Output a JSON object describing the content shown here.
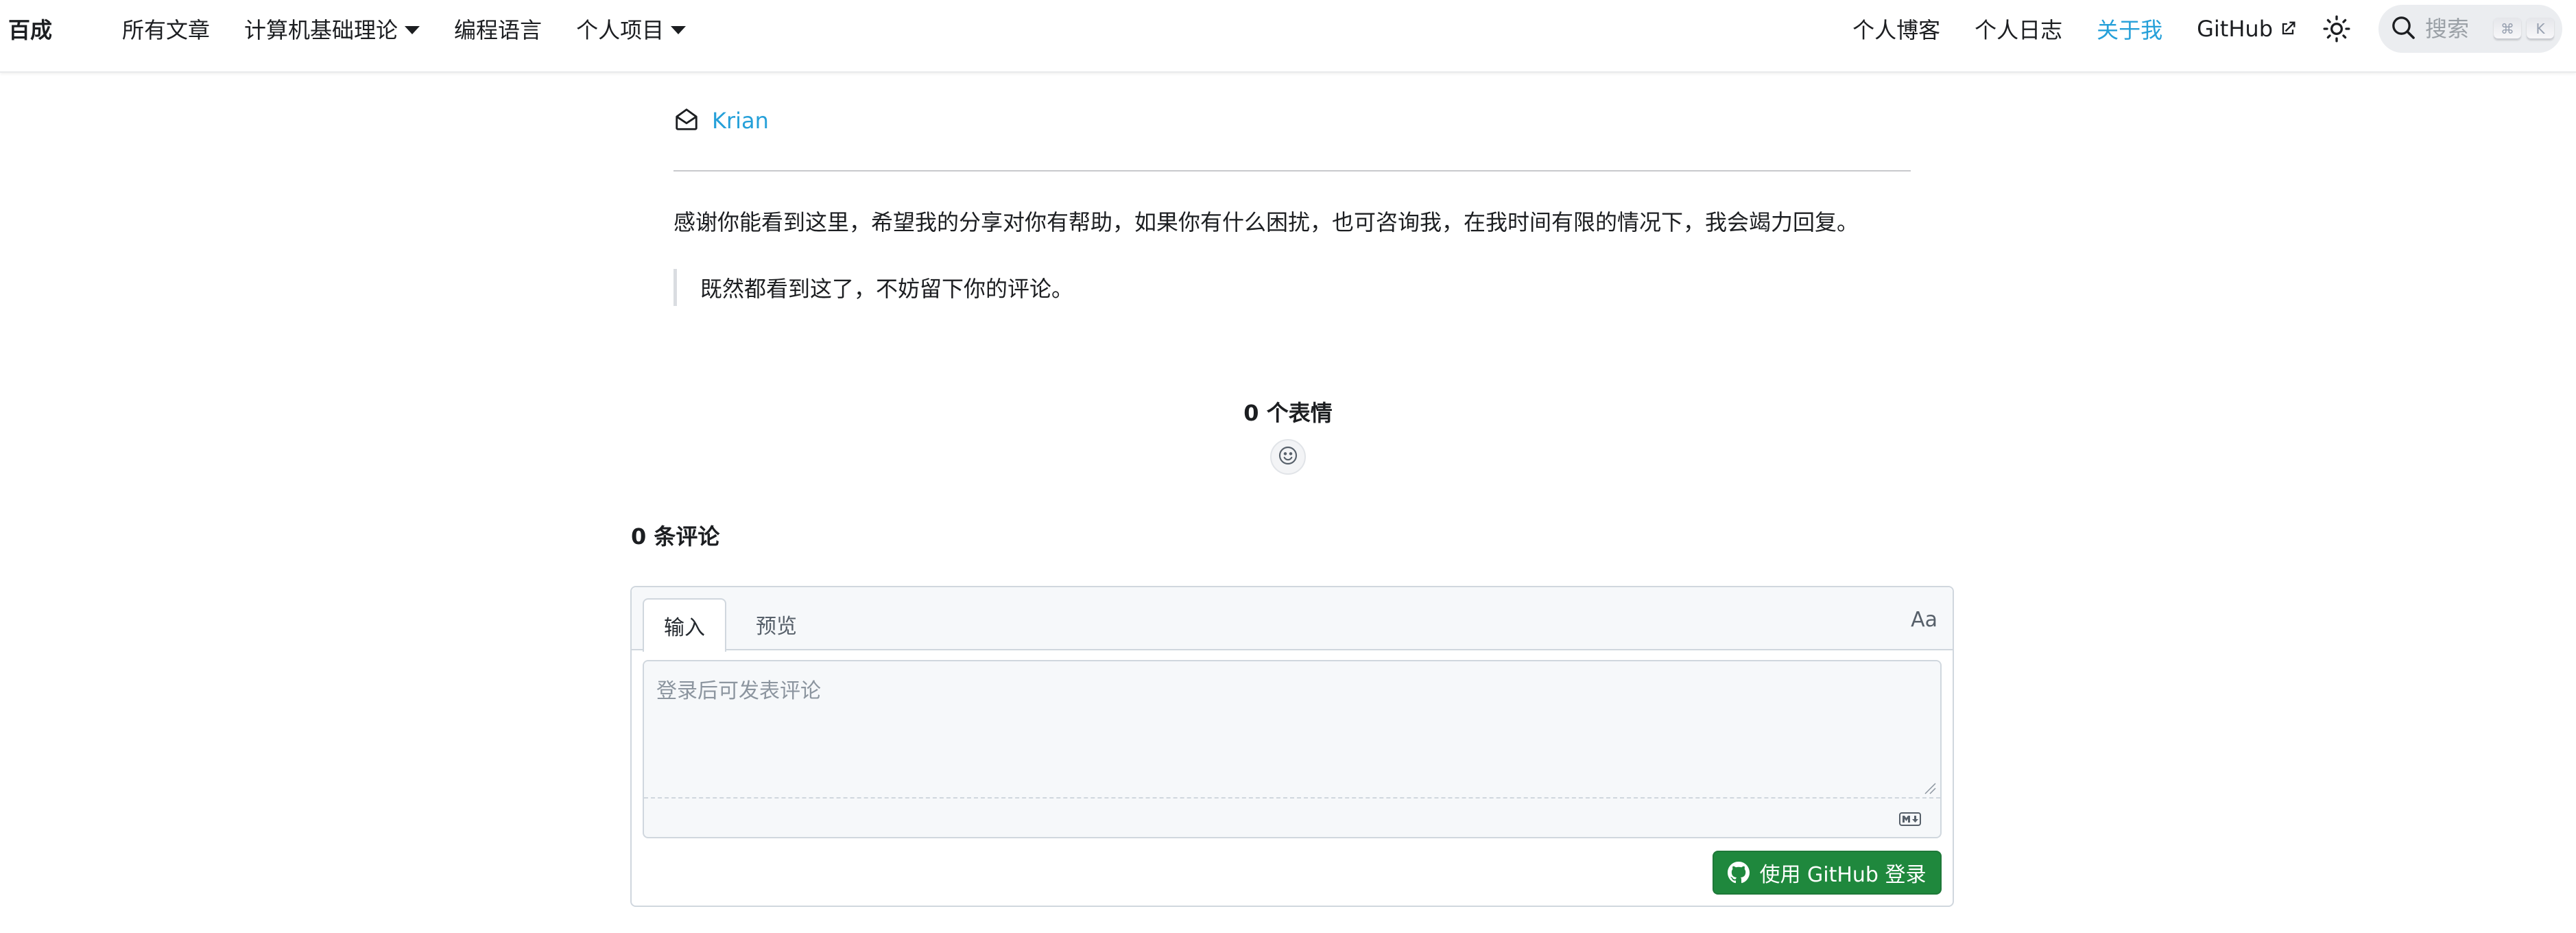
{
  "navbar": {
    "brand": "百成",
    "left_items": [
      {
        "label": "所有文章"
      },
      {
        "label": "计算机基础理论",
        "dropdown": true
      },
      {
        "label": "编程语言"
      },
      {
        "label": "个人项目",
        "dropdown": true
      }
    ],
    "right_items": [
      {
        "label": "个人博客"
      },
      {
        "label": "个人日志"
      },
      {
        "label": "关于我",
        "active": true
      },
      {
        "label": "GitHub",
        "external": true
      }
    ],
    "search": {
      "placeholder": "搜索",
      "shortcut_keys": [
        "⌘",
        "K"
      ]
    }
  },
  "article": {
    "email_link": "Krian",
    "thanks_text": "感谢你能看到这里，希望我的分享对你有帮助，如果你有什么困扰，也可咨询我，在我时间有限的情况下，我会竭力回复。",
    "quote_text": "既然都看到这了，不妨留下你的评论。"
  },
  "reactions": {
    "count_label": "0 个表情"
  },
  "comments": {
    "count_label": "0 条评论",
    "tabs": [
      {
        "label": "输入",
        "active": true
      },
      {
        "label": "预览",
        "active": false
      }
    ],
    "font_toggle": "Aa",
    "textarea_placeholder": "登录后可发表评论",
    "login_button": "使用 GitHub 登录"
  },
  "colors": {
    "accent": "#25a0d9",
    "login_button": "#1f883d"
  }
}
